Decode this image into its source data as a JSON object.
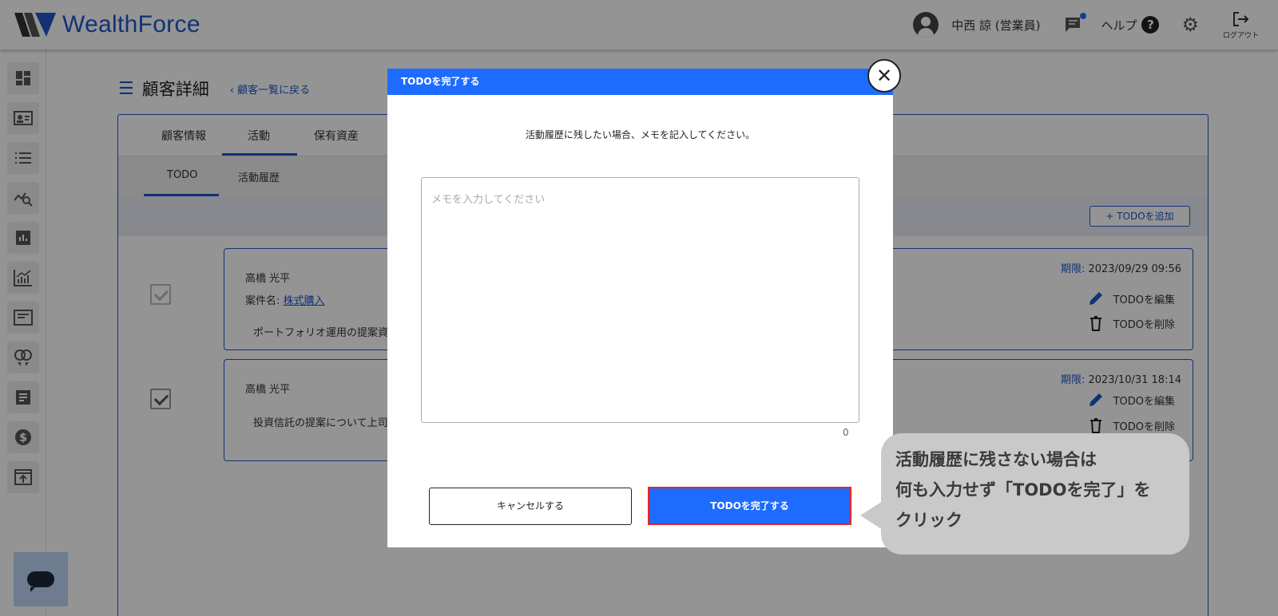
{
  "header": {
    "logo_text": "WealthForce",
    "user_name": "中西 諒 (営業員)",
    "help_label": "ヘルプ",
    "help_icon": "?",
    "logout_label": "ログアウト"
  },
  "sidebar": {
    "icons": [
      "dashboard-icon",
      "contact-card-icon",
      "list-icon",
      "analytics-search-icon",
      "bar-chart-icon",
      "growth-chart-icon",
      "article-icon",
      "rings-icon",
      "document-icon",
      "dollar-icon",
      "upload-box-icon"
    ]
  },
  "page": {
    "title": "顧客詳細",
    "back_link": "顧客一覧に戻る"
  },
  "tabs": [
    {
      "label": "顧客情報"
    },
    {
      "label": "活動"
    },
    {
      "label": "保有資産"
    }
  ],
  "subtabs": [
    {
      "label": "TODO"
    },
    {
      "label": "活動履歴"
    }
  ],
  "toolbar": {
    "add_todo_label": "+ TODOを追加"
  },
  "todos": [
    {
      "person": "高橋 光平",
      "case_label": "案件名: ",
      "case_name": "株式購入",
      "description": "ポートフォリオ運用の提案資料",
      "deadline_label": "期限:",
      "deadline": "2023/09/29 09:56",
      "edit_label": "TODOを編集",
      "delete_label": "TODOを削除"
    },
    {
      "person": "高橋 光平",
      "description": "投資信託の提案について上司へ",
      "deadline_label": "期限:",
      "deadline": "2023/10/31 18:14",
      "edit_label": "TODOを編集",
      "delete_label": "TODOを削除"
    }
  ],
  "modal": {
    "title": "TODOを完了する",
    "instruction": "活動履歴に残したい場合、メモを記入してください。",
    "memo_placeholder": "メモを入力してください",
    "memo_value": "",
    "char_count": "0",
    "cancel_label": "キャンセルする",
    "complete_label": "TODOを完了する"
  },
  "callout": {
    "line1": "活動履歴に残さない場合は",
    "line2": "何も入力せず「TODOを完了」を",
    "line3": "クリック"
  },
  "colors": {
    "brand_blue": "#1e56c8",
    "button_blue": "#1e6bff",
    "highlight_red": "#e8242c"
  }
}
